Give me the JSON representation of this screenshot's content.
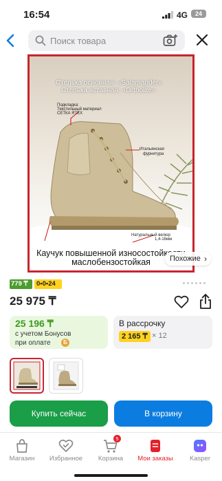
{
  "status_bar": {
    "time": "16:54",
    "network": "4G",
    "battery": "24"
  },
  "search": {
    "placeholder": "Поиск товара"
  },
  "product_image": {
    "headline_1": "Стелька основная: «Salamander»",
    "headline_2": "Стелька вставная: «Ortholite»",
    "label_lining_1": "Подкладка:",
    "label_lining_2": "Текстильный материал",
    "label_lining_3": "СЕТКА ЯТЕХ",
    "label_fittings_1": "Итальянская",
    "label_fittings_2": "фурнитура",
    "label_velour_1": "Натуральный велюр",
    "label_velour_2": "1,4-16мм",
    "bottom_line_1": "Каучук повышенной износостойкости",
    "bottom_line_2": "маслобензостойкая",
    "similar_label": "Похожие",
    "similar_arrow": "›"
  },
  "badges": {
    "rating": "779 ₸",
    "installment": "0•0•24"
  },
  "price": {
    "main": "25 975 ₸"
  },
  "bonus": {
    "value": "25 196 ₸",
    "line1": "с учетом Бонусов",
    "line2": "при оплате",
    "bonus_icon": "Б"
  },
  "installment": {
    "title": "В рассрочку",
    "amount": "2 165 ₸",
    "multiplier": "× 12"
  },
  "actions": {
    "buy": "Купить сейчас",
    "cart": "В корзину"
  },
  "tabbar": {
    "items": [
      {
        "label": "Магазин",
        "icon": "shop-icon"
      },
      {
        "label": "Избранное",
        "icon": "heart-check-icon"
      },
      {
        "label": "Корзина",
        "icon": "cart-icon",
        "badge": "5"
      },
      {
        "label": "Мои заказы",
        "icon": "orders-icon",
        "active": true
      },
      {
        "label": "Kasper",
        "icon": "kasper-icon"
      }
    ]
  },
  "colors": {
    "accent_red": "#e3212b",
    "green": "#1a9e47",
    "blue": "#0c7de0",
    "yellow": "#ffd21e"
  }
}
